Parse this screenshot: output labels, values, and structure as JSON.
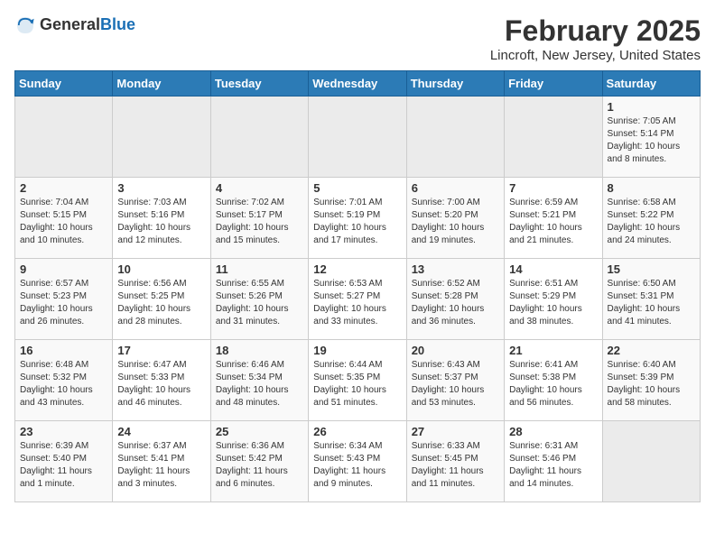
{
  "header": {
    "logo_general": "General",
    "logo_blue": "Blue",
    "month": "February 2025",
    "location": "Lincroft, New Jersey, United States"
  },
  "weekdays": [
    "Sunday",
    "Monday",
    "Tuesday",
    "Wednesday",
    "Thursday",
    "Friday",
    "Saturday"
  ],
  "weeks": [
    [
      {
        "day": "",
        "empty": true
      },
      {
        "day": "",
        "empty": true
      },
      {
        "day": "",
        "empty": true
      },
      {
        "day": "",
        "empty": true
      },
      {
        "day": "",
        "empty": true
      },
      {
        "day": "",
        "empty": true
      },
      {
        "day": "1",
        "sunrise": "7:05 AM",
        "sunset": "5:14 PM",
        "daylight": "10 hours and 8 minutes."
      }
    ],
    [
      {
        "day": "2",
        "sunrise": "7:04 AM",
        "sunset": "5:15 PM",
        "daylight": "10 hours and 10 minutes."
      },
      {
        "day": "3",
        "sunrise": "7:03 AM",
        "sunset": "5:16 PM",
        "daylight": "10 hours and 12 minutes."
      },
      {
        "day": "4",
        "sunrise": "7:02 AM",
        "sunset": "5:17 PM",
        "daylight": "10 hours and 15 minutes."
      },
      {
        "day": "5",
        "sunrise": "7:01 AM",
        "sunset": "5:19 PM",
        "daylight": "10 hours and 17 minutes."
      },
      {
        "day": "6",
        "sunrise": "7:00 AM",
        "sunset": "5:20 PM",
        "daylight": "10 hours and 19 minutes."
      },
      {
        "day": "7",
        "sunrise": "6:59 AM",
        "sunset": "5:21 PM",
        "daylight": "10 hours and 21 minutes."
      },
      {
        "day": "8",
        "sunrise": "6:58 AM",
        "sunset": "5:22 PM",
        "daylight": "10 hours and 24 minutes."
      }
    ],
    [
      {
        "day": "9",
        "sunrise": "6:57 AM",
        "sunset": "5:23 PM",
        "daylight": "10 hours and 26 minutes."
      },
      {
        "day": "10",
        "sunrise": "6:56 AM",
        "sunset": "5:25 PM",
        "daylight": "10 hours and 28 minutes."
      },
      {
        "day": "11",
        "sunrise": "6:55 AM",
        "sunset": "5:26 PM",
        "daylight": "10 hours and 31 minutes."
      },
      {
        "day": "12",
        "sunrise": "6:53 AM",
        "sunset": "5:27 PM",
        "daylight": "10 hours and 33 minutes."
      },
      {
        "day": "13",
        "sunrise": "6:52 AM",
        "sunset": "5:28 PM",
        "daylight": "10 hours and 36 minutes."
      },
      {
        "day": "14",
        "sunrise": "6:51 AM",
        "sunset": "5:29 PM",
        "daylight": "10 hours and 38 minutes."
      },
      {
        "day": "15",
        "sunrise": "6:50 AM",
        "sunset": "5:31 PM",
        "daylight": "10 hours and 41 minutes."
      }
    ],
    [
      {
        "day": "16",
        "sunrise": "6:48 AM",
        "sunset": "5:32 PM",
        "daylight": "10 hours and 43 minutes."
      },
      {
        "day": "17",
        "sunrise": "6:47 AM",
        "sunset": "5:33 PM",
        "daylight": "10 hours and 46 minutes."
      },
      {
        "day": "18",
        "sunrise": "6:46 AM",
        "sunset": "5:34 PM",
        "daylight": "10 hours and 48 minutes."
      },
      {
        "day": "19",
        "sunrise": "6:44 AM",
        "sunset": "5:35 PM",
        "daylight": "10 hours and 51 minutes."
      },
      {
        "day": "20",
        "sunrise": "6:43 AM",
        "sunset": "5:37 PM",
        "daylight": "10 hours and 53 minutes."
      },
      {
        "day": "21",
        "sunrise": "6:41 AM",
        "sunset": "5:38 PM",
        "daylight": "10 hours and 56 minutes."
      },
      {
        "day": "22",
        "sunrise": "6:40 AM",
        "sunset": "5:39 PM",
        "daylight": "10 hours and 58 minutes."
      }
    ],
    [
      {
        "day": "23",
        "sunrise": "6:39 AM",
        "sunset": "5:40 PM",
        "daylight": "11 hours and 1 minute."
      },
      {
        "day": "24",
        "sunrise": "6:37 AM",
        "sunset": "5:41 PM",
        "daylight": "11 hours and 3 minutes."
      },
      {
        "day": "25",
        "sunrise": "6:36 AM",
        "sunset": "5:42 PM",
        "daylight": "11 hours and 6 minutes."
      },
      {
        "day": "26",
        "sunrise": "6:34 AM",
        "sunset": "5:43 PM",
        "daylight": "11 hours and 9 minutes."
      },
      {
        "day": "27",
        "sunrise": "6:33 AM",
        "sunset": "5:45 PM",
        "daylight": "11 hours and 11 minutes."
      },
      {
        "day": "28",
        "sunrise": "6:31 AM",
        "sunset": "5:46 PM",
        "daylight": "11 hours and 14 minutes."
      },
      {
        "day": "",
        "empty": true
      }
    ]
  ]
}
